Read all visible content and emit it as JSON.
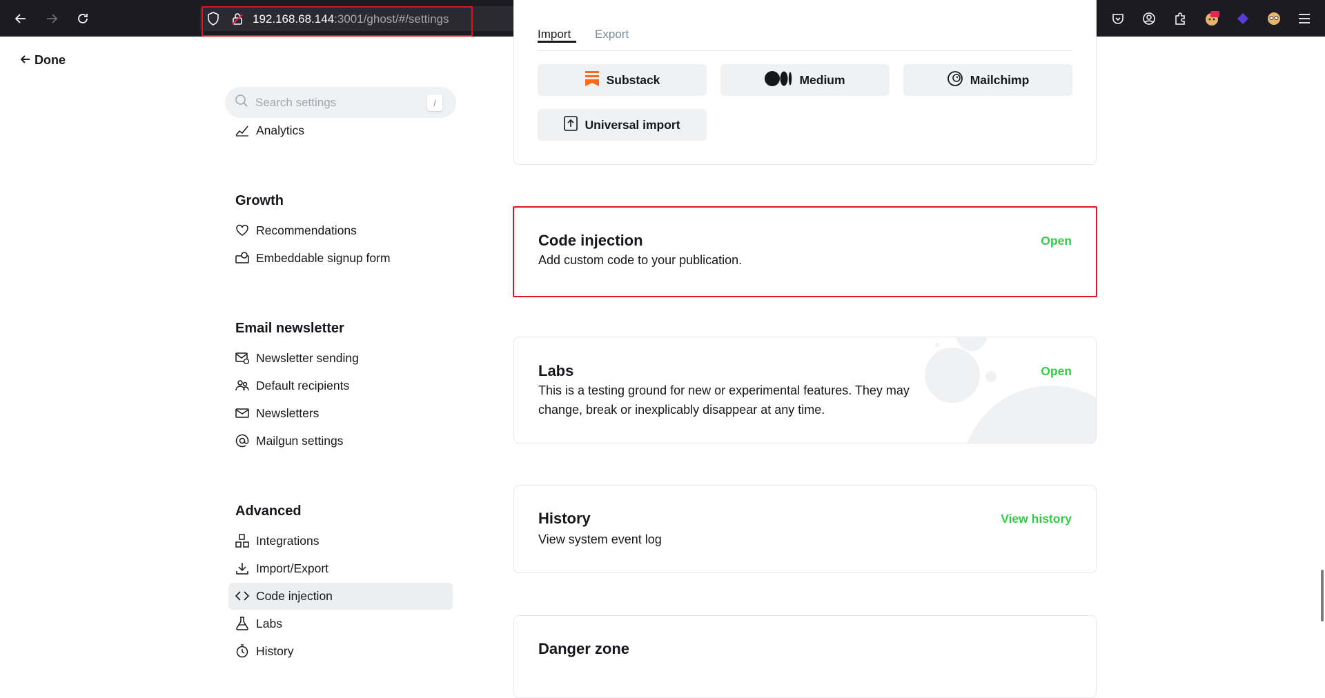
{
  "browser": {
    "url_host": "192.168.68.144",
    "url_path": ":3001/ghost/#/settings"
  },
  "sidebar": {
    "done_label": "Done",
    "search_placeholder": "Search settings",
    "search_shortcut": "/",
    "analytics": "Analytics",
    "growth": {
      "heading": "Growth",
      "items": [
        "Recommendations",
        "Embeddable signup form"
      ]
    },
    "email": {
      "heading": "Email newsletter",
      "items": [
        "Newsletter sending",
        "Default recipients",
        "Newsletters",
        "Mailgun settings"
      ]
    },
    "advanced": {
      "heading": "Advanced",
      "items": [
        "Integrations",
        "Import/Export",
        "Code injection",
        "Labs",
        "History"
      ],
      "active": "Code injection"
    }
  },
  "import_export": {
    "tabs": [
      "Import",
      "Export"
    ],
    "buttons": [
      "Substack",
      "Medium",
      "Mailchimp",
      "Universal import"
    ]
  },
  "code_injection": {
    "title": "Code injection",
    "description": "Add custom code to your publication.",
    "action": "Open"
  },
  "labs": {
    "title": "Labs",
    "description_line1": "This is a testing ground for new or experimental features. They may",
    "description_line2": "change, break or inexplicably disappear at any time.",
    "action": "Open"
  },
  "history": {
    "title": "History",
    "description": "View system event log",
    "action": "View history"
  },
  "danger_zone": {
    "title": "Danger zone"
  },
  "colors": {
    "accent_green": "#30cf43",
    "highlight_red": "#d8161f",
    "substack_orange": "#ff6719"
  }
}
